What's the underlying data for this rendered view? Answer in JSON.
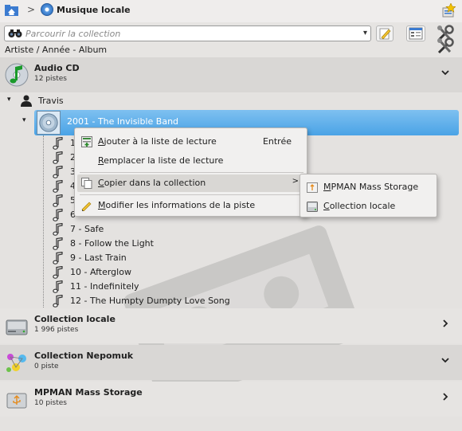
{
  "header": {
    "title": "Musique locale",
    "separator": ">"
  },
  "search": {
    "placeholder": "Parcourir la collection",
    "dropdown": "▾"
  },
  "sort_label": "Artiste / Année - Album",
  "sources": {
    "audio_cd": {
      "name": "Audio CD",
      "count": "12 pistes"
    },
    "local": {
      "name": "Collection locale",
      "count": "1 996 pistes"
    },
    "nepomuk": {
      "name": "Collection Nepomuk",
      "count": "0 piste"
    },
    "mpman": {
      "name": "MPMAN Mass Storage",
      "count": "10 pistes"
    }
  },
  "artist": {
    "name": "Travis",
    "expander": "▾"
  },
  "album": {
    "name": "2001 - The Invisible Band",
    "expander": "▾"
  },
  "tracks": [
    {
      "label": "1"
    },
    {
      "label": "2"
    },
    {
      "label": "3"
    },
    {
      "label": "4"
    },
    {
      "label": "5"
    },
    {
      "label": "6"
    },
    {
      "label": "7 - Safe"
    },
    {
      "label": "8 - Follow the Light"
    },
    {
      "label": "9 - Last Train"
    },
    {
      "label": "10 - Afterglow"
    },
    {
      "label": "11 - Indefinitely"
    },
    {
      "label": "12 - The Humpty Dumpty Love Song"
    }
  ],
  "context_menu": {
    "add_playlist": {
      "pre": "",
      "u": "A",
      "post": "jouter à la liste de lecture",
      "shortcut": "Entrée"
    },
    "replace_playlist": {
      "pre": "",
      "u": "R",
      "post": "emplacer la liste de lecture"
    },
    "copy_to_collection": {
      "pre": "",
      "u": "C",
      "post": "opier dans la collection",
      "arrow": ">"
    },
    "edit_track_info": {
      "pre": "",
      "u": "M",
      "post": "odifier les informations de la piste"
    }
  },
  "submenu": {
    "mpman": {
      "pre": "",
      "u": "M",
      "post": "PMAN Mass Storage"
    },
    "local": {
      "pre": "",
      "u": "C",
      "post": "ollection locale"
    }
  },
  "colors": {
    "selection": "#4aa3e6",
    "menu_bg": "#f1f0ef"
  }
}
